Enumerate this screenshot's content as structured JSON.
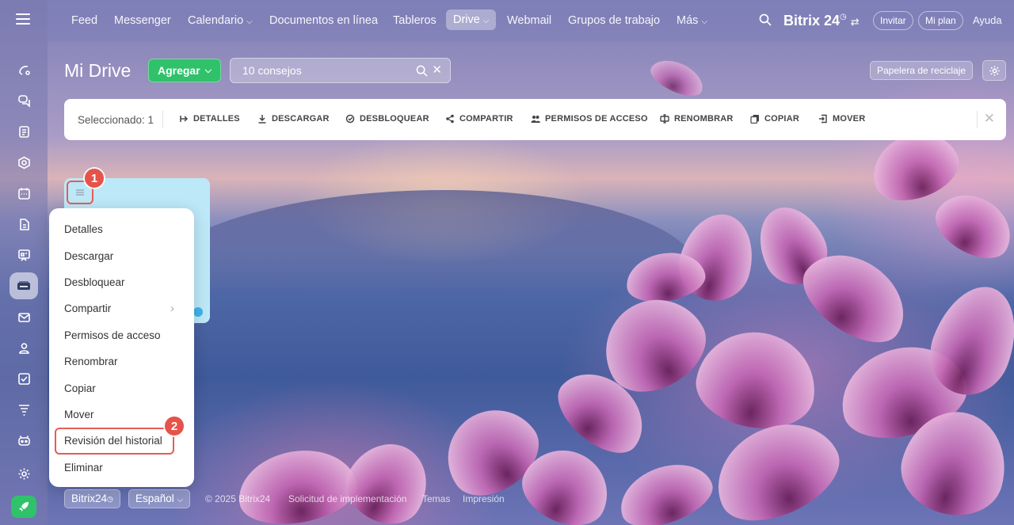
{
  "topnav": {
    "items": [
      "Feed",
      "Messenger",
      "Calendario",
      "Documentos en línea",
      "Tableros",
      "Drive",
      "Webmail",
      "Grupos de trabajo",
      "Más"
    ],
    "brand": "Bitrix 24",
    "invite": "Invitar",
    "plan": "Mi plan",
    "help": "Ayuda"
  },
  "page": {
    "title": "Mi Drive",
    "add_label": "Agregar",
    "search_value": "10 consejos",
    "trash_label": "Papelera de reciclaje"
  },
  "toolbar": {
    "selected": "Seleccionado: 1",
    "actions": [
      "DETALLES",
      "DESCARGAR",
      "DESBLOQUEAR",
      "COMPARTIR",
      "PERMISOS DE ACCESO",
      "RENOMBRAR",
      "COPIAR",
      "MOVER"
    ]
  },
  "callouts": [
    "1",
    "2"
  ],
  "menu": {
    "items": [
      "Detalles",
      "Descargar",
      "Desbloquear",
      "Compartir",
      "Permisos de acceso",
      "Renombrar",
      "Copiar",
      "Mover",
      "Revisión del historial",
      "Eliminar"
    ]
  },
  "footer": {
    "brand": "Bitrix24",
    "language": "Español",
    "copyright": "© 2025 Bitrix24",
    "links": [
      "Solicitud de implementación",
      "Temas",
      "Impresión"
    ]
  },
  "colors": {
    "accent_green": "#2fc26b",
    "highlight_red": "#e45d57",
    "tile_blue": "#bde8f8"
  }
}
